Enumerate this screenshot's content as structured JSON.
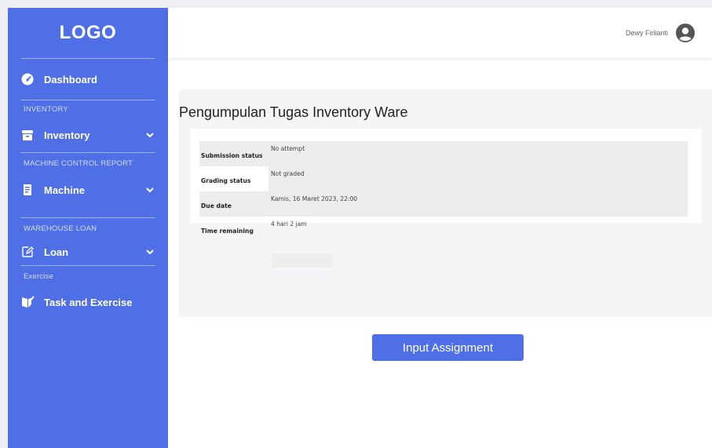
{
  "colors": {
    "accent": "#4f6fe6",
    "sidebar_text": "#ffffff",
    "table_shade": "#ececec"
  },
  "sidebar": {
    "logo": "LOGO",
    "dashboard": {
      "label": "Dashboard",
      "icon": "speedometer-icon"
    },
    "sections": [
      {
        "title": "INVENTORY",
        "item": {
          "label": "Inventory",
          "icon": "archive-box-icon",
          "has_chevron": true
        }
      },
      {
        "title": "MACHINE CONTROL REPORT",
        "item": {
          "label": "Machine",
          "icon": "document-report-icon",
          "has_chevron": true
        }
      },
      {
        "title": "WAREHOUSE LOAN",
        "item": {
          "label": "Loan",
          "icon": "edit-pencil-icon",
          "has_chevron": true
        }
      },
      {
        "title": "Exercise",
        "item": {
          "label": "Task and Exercise",
          "icon": "task-book-icon",
          "has_chevron": false
        }
      }
    ]
  },
  "header": {
    "username": "Dewy Firlianti",
    "avatar_icon": "user-circle-icon"
  },
  "main": {
    "title": "Pengumpulan Tugas Inventory Ware",
    "status_rows": [
      {
        "label": "Submission status",
        "value": "No attempt"
      },
      {
        "label": "Grading status",
        "value": "Not graded"
      },
      {
        "label": "Due date",
        "value": "Kamis, 16 Maret 2023, 22:00"
      },
      {
        "label": "Time remaining",
        "value": "4 hari 2 jam"
      }
    ],
    "submit_button": "Input Assignment"
  }
}
